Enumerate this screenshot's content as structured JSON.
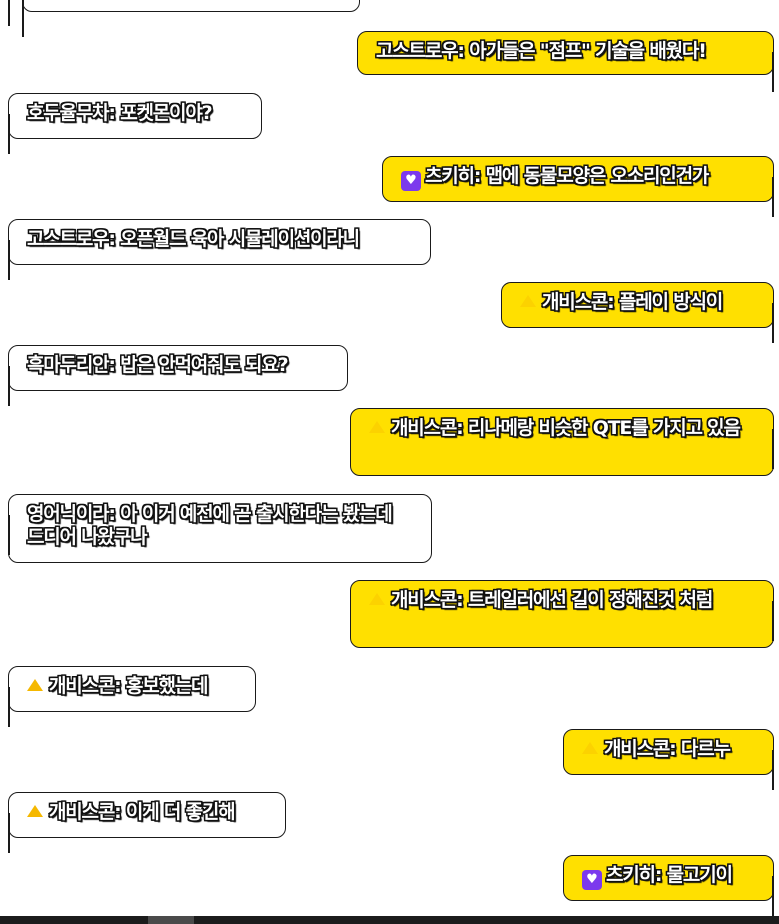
{
  "chat": {
    "top_partial": "· · · · · · · · ·",
    "messages": [
      {
        "side": "right",
        "badge": "",
        "text": "고스트로우: 아가들은 \"점프\" 기술을 배웠다!"
      },
      {
        "side": "left",
        "badge": "",
        "text": "호두율무차: 포켓몬이야?"
      },
      {
        "side": "right",
        "badge": "heart",
        "text": "츠키히: 맵에 동물모양은 오소리인건가"
      },
      {
        "side": "left",
        "badge": "",
        "text": "고스트로우: 오픈월드 육아 시뮬레이션이라니"
      },
      {
        "side": "right",
        "badge": "cheese-faint",
        "text": "개비스콘: 플레이 방식이"
      },
      {
        "side": "left",
        "badge": "",
        "text": "흑마두리안: 밥은 안먹여줘도 되요?"
      },
      {
        "side": "right",
        "badge": "cheese-faint",
        "text": "개비스콘: 리나메랑 비슷한 QTE를 가지고 있음"
      },
      {
        "side": "left",
        "badge": "",
        "text": "영어닉이라: 아 이거 예전에 곧 출시한다는 봤는데 드디어 나왔구나"
      },
      {
        "side": "right",
        "badge": "cheese-faint",
        "text": "개비스콘: 트레일러에선 길이 정해진것 처럼"
      },
      {
        "side": "left",
        "badge": "cheese",
        "text": "개비스콘: 홍보했는데"
      },
      {
        "side": "right",
        "badge": "cheese-faint",
        "text": "개비스콘: 다르누"
      },
      {
        "side": "left",
        "badge": "cheese",
        "text": "개비스콘: 이게 더 좋긴해"
      },
      {
        "side": "right",
        "badge": "heart",
        "text": "츠키히: 물고기이"
      }
    ]
  },
  "colors": {
    "left_bg": "#ffffff",
    "right_bg": "#ffe000",
    "heart_badge": "#7c3aed",
    "cheese": "#f5b800"
  },
  "icons": {
    "heart": "heart-badge-icon",
    "cheese": "cheese-icon"
  }
}
